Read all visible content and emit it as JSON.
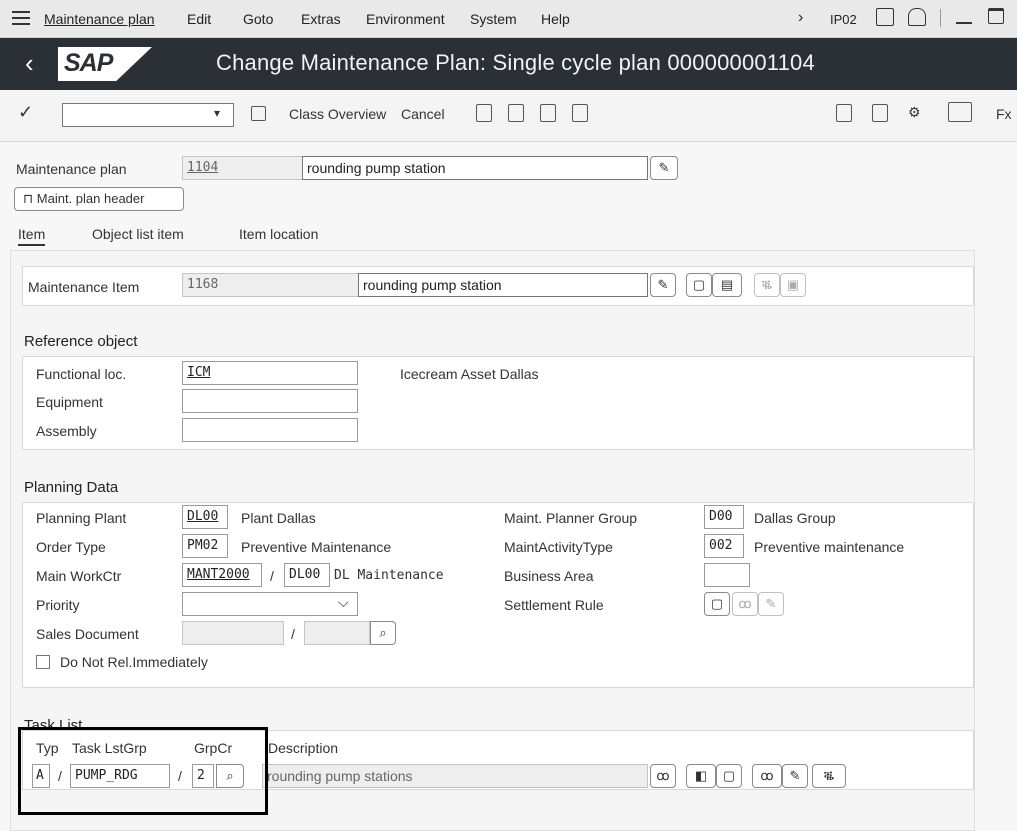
{
  "menubar": {
    "items": [
      "Maintenance plan",
      "Edit",
      "Goto",
      "Extras",
      "Environment",
      "System",
      "Help"
    ],
    "tcode": "IP02"
  },
  "title": "Change Maintenance Plan: Single cycle plan 000000001104",
  "logo": "SAP",
  "toolbar": {
    "class_overview": "Class Overview",
    "cancel": "Cancel",
    "fx": "Fx"
  },
  "header": {
    "plan_label": "Maintenance plan",
    "plan_number": "1104",
    "plan_text": "rounding pump station",
    "header_button": "Maint. plan header"
  },
  "tabs": [
    "Item",
    "Object list item",
    "Item location"
  ],
  "item": {
    "label": "Maintenance Item",
    "number": "1168",
    "text": "rounding pump station"
  },
  "reference_object": {
    "title": "Reference object",
    "functional_loc_label": "Functional loc.",
    "functional_loc_value": "ICM",
    "functional_loc_desc": "Icecream Asset Dallas",
    "equipment_label": "Equipment",
    "equipment_value": "",
    "assembly_label": "Assembly",
    "assembly_value": ""
  },
  "planning": {
    "title": "Planning Data",
    "planning_plant_label": "Planning Plant",
    "planning_plant_value": "DL00",
    "planning_plant_desc": "Plant Dallas",
    "order_type_label": "Order Type",
    "order_type_value": "PM02",
    "order_type_desc": "Preventive Maintenance",
    "main_workctr_label": "Main WorkCtr",
    "main_workctr_value": "MANT2000",
    "main_workctr_plant": "DL00",
    "main_workctr_desc": "DL Maintenance",
    "priority_label": "Priority",
    "priority_value": "",
    "sales_doc_label": "Sales Document",
    "do_not_rel_label": "Do Not Rel.Immediately",
    "planner_group_label": "Maint. Planner Group",
    "planner_group_value": "D00",
    "planner_group_desc": "Dallas Group",
    "activity_type_label": "MaintActivityType",
    "activity_type_value": "002",
    "activity_type_desc": "Preventive maintenance",
    "business_area_label": "Business Area",
    "business_area_value": "",
    "settlement_rule_label": "Settlement Rule"
  },
  "task_list": {
    "title": "Task List",
    "typ_label": "Typ",
    "grp_label": "Task LstGrp",
    "grpcr_label": "GrpCr",
    "desc_label": "Description",
    "typ_value": "A",
    "grp_value": "PUMP_RDG",
    "grpcr_value": "2",
    "desc_value": "rounding pump stations"
  },
  "separator": "/",
  "colors": {
    "titlebar": "#2b2f36",
    "menubar": "#e9e9e9",
    "highlight_box": "#000000"
  }
}
